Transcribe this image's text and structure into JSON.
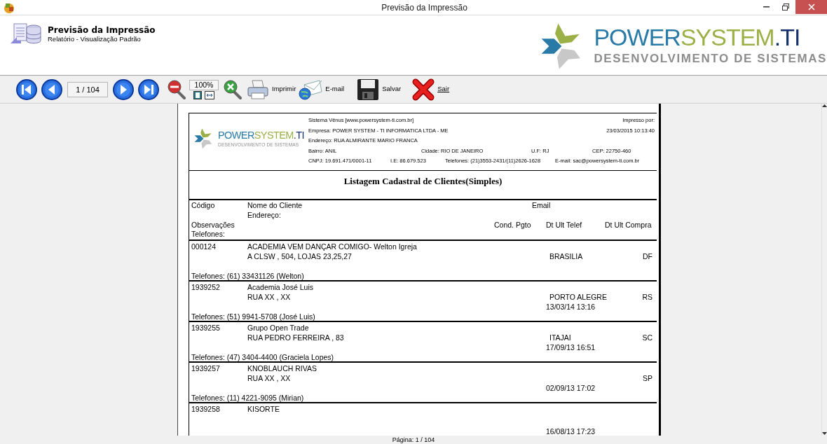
{
  "window": {
    "title": "Previsão da Impressão"
  },
  "header": {
    "title": "Previsão da Impressão",
    "subtitle": "Relatório - Visualização Padrão",
    "logo": {
      "word_1": "POWER",
      "word_2": "SYSTEM",
      "word_3": ".TI",
      "tagline": "DESENVOLVIMENTO DE SISTEMAS"
    }
  },
  "toolbar": {
    "items": [
      {
        "kind": "first"
      },
      {
        "kind": "prev"
      },
      {
        "kind": "page",
        "value": "1 / 104"
      },
      {
        "kind": "next"
      },
      {
        "kind": "last"
      },
      {
        "kind": "zoom_out"
      },
      {
        "kind": "zoom",
        "value": "100%"
      },
      {
        "kind": "zoom_reset"
      },
      {
        "kind": "print",
        "label": "Imprimir"
      },
      {
        "kind": "email",
        "label": "E-mail"
      },
      {
        "kind": "save",
        "label": "Salvar"
      },
      {
        "kind": "exit",
        "label": "Sair"
      }
    ]
  },
  "report": {
    "logo": {
      "word_1": "POWER",
      "word_2": "SYSTEM",
      "word_3": ".TI",
      "tagline": "DESENVOLVIMENTO DE SISTEMAS"
    },
    "info_lines": [
      [
        "Sistema Vênus [www.powersystem-ti.com.br]"
      ],
      [
        "Empresa:  POWER SYSTEM - TI INFORMATICA LTDA - ME"
      ],
      [
        "Endereço:  RUA ALMIRANTE MARIO FRANCA"
      ],
      [
        "Bairro:  ANIL",
        "Cidade:  RIO DE JANEIRO",
        "U.F:  RJ",
        "CEP: 22750-460"
      ],
      [
        "CNPJ:  19.691.471/0001-11",
        "I.E:  86.679.523",
        "Telefones:  (21)3553-2431/(11)2626-1628",
        "E-mail:  sac@powersystem-ti.com.br"
      ]
    ],
    "printed_by": "Impresso por:",
    "printed_at": "23/03/2015 10:13:40",
    "title": "Listagem Cadastral de Clientes(Simples)",
    "columns": {
      "code": "Código",
      "name": "Nome do Cliente",
      "email": "Email",
      "address": "Endereço:",
      "notes": "Observações",
      "payment": "Cond. Pgto",
      "last_call": "Dt Ult Telef",
      "last_purchase": "Dt Ult Compra",
      "phones": "Telefones:"
    },
    "rows": [
      {
        "code": "000124",
        "name": "ACADEMIA VEM DANÇAR COMIGO- Welton Igreja",
        "address": " A CLSW , 504,  LOJAS 23,25,27",
        "city": "BRASILIA",
        "uf": "DF",
        "phones": "Telefones:  (61) 33431126 (Welton)"
      },
      {
        "code": "1939252",
        "name": "Academia José Luis",
        "address": "RUA XX , XX",
        "city": "PORTO ALEGRE",
        "uf": "RS",
        "date": "13/03/14 13:16",
        "phones": "Telefones:  (51) 9941-5708 (José Luis)"
      },
      {
        "code": "1939255",
        "name": "Grupo Open Trade",
        "address": "RUA PEDRO FERREIRA , 83",
        "city": "ITAJAI",
        "uf": "SC",
        "date": "17/09/13 16:51",
        "phones": "Telefones:  (47) 3404-4400 (Graciela Lopes)"
      },
      {
        "code": "1939257",
        "name": "KNOBLAUCH RIVAS",
        "address": "RUA XX , XX",
        "uf": "SP",
        "date": "02/09/13 17:02",
        "phones": "Telefones:  (11) 4221-9095 (Mirian)"
      },
      {
        "code": "1939258",
        "name": "KISORTE",
        "date": "16/08/13 17:23"
      }
    ]
  },
  "status_bar": "Página: 1 / 104"
}
